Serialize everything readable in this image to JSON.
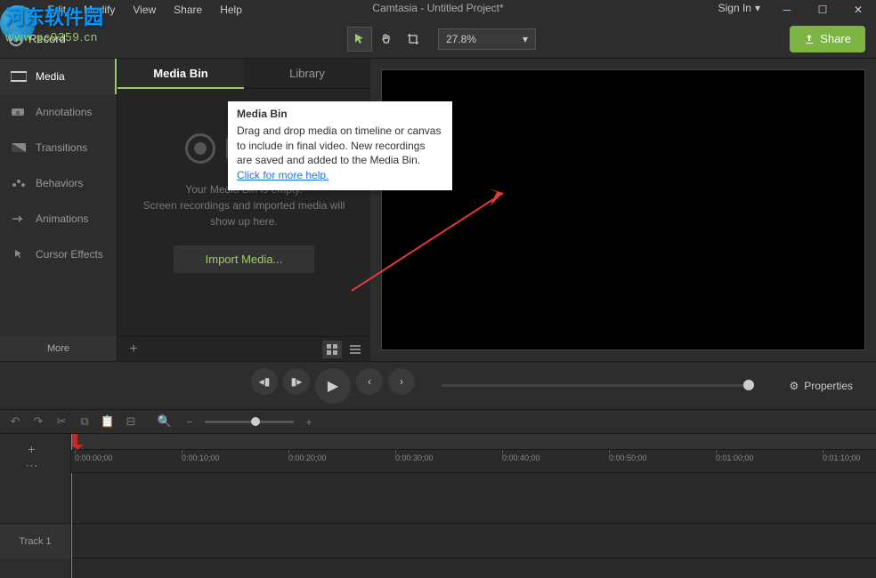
{
  "window": {
    "title": "Camtasia - Untitled Project*",
    "signin": "Sign In"
  },
  "menus": [
    "File",
    "Edit",
    "Modify",
    "View",
    "Share",
    "Help"
  ],
  "watermark": {
    "zh": "河东软件园",
    "url": "www.pc0359.cn"
  },
  "toolbar": {
    "record": "Record",
    "zoom": "27.8%",
    "share": "Share"
  },
  "sidebar": {
    "items": [
      {
        "label": "Media"
      },
      {
        "label": "Annotations"
      },
      {
        "label": "Transitions"
      },
      {
        "label": "Behaviors"
      },
      {
        "label": "Animations"
      },
      {
        "label": "Cursor Effects"
      }
    ],
    "more": "More"
  },
  "tabs": {
    "mediaBin": "Media Bin",
    "library": "Library"
  },
  "bin": {
    "empty1": "Your Media Bin is empty.",
    "empty2": "Screen recordings and imported media will show up here.",
    "import": "Import Media..."
  },
  "tooltip": {
    "title": "Media Bin",
    "body": "Drag and drop media on timeline or canvas to include in final video. New recordings are saved and added to the Media Bin.",
    "link": "Click for more help."
  },
  "playback": {
    "properties": "Properties"
  },
  "timeline": {
    "current": "0:00:00;00",
    "track": "Track 1",
    "ticks": [
      "0:00:00;00",
      "0:00:10;00",
      "0:00:20;00",
      "0:00:30;00",
      "0:00:40;00",
      "0:00:50;00",
      "0:01:00;00",
      "0:01:10;00"
    ]
  }
}
